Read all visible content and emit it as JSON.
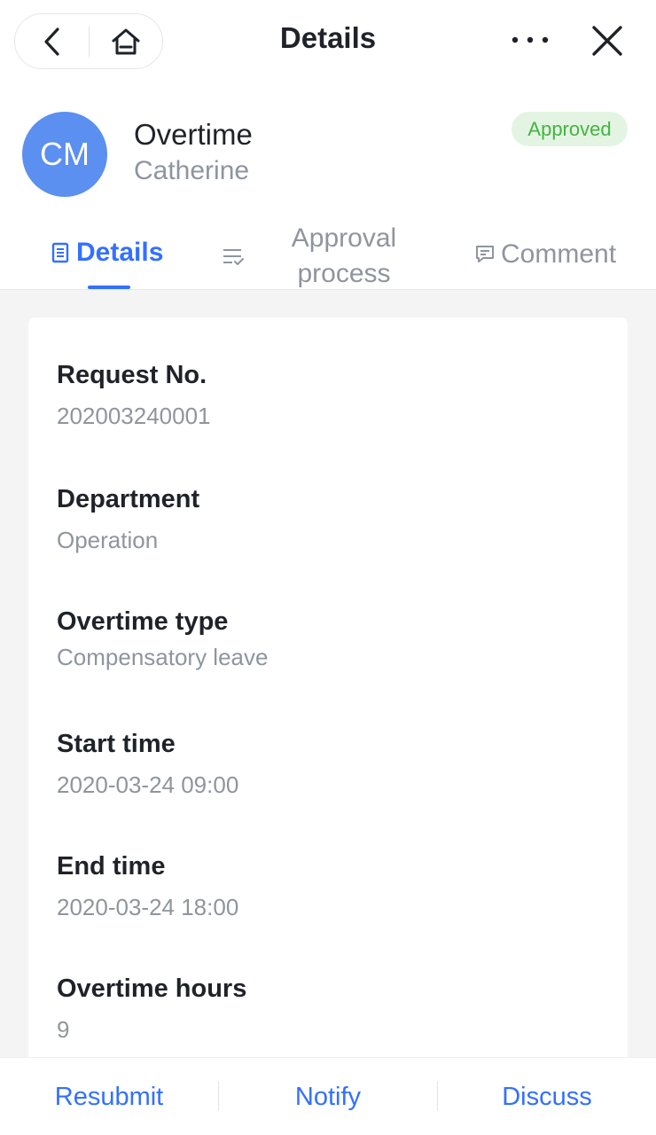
{
  "header": {
    "title": "Details",
    "back_icon": "chevron-left-icon",
    "home_icon": "home-icon",
    "more_icon": "more-horizontal-icon",
    "close_icon": "close-icon"
  },
  "request": {
    "avatar_initials": "CM",
    "avatar_color": "#5b8ff0",
    "title": "Overtime",
    "applicant": "Catherine",
    "status": "Approved",
    "status_color": "#45b342"
  },
  "tabs": [
    {
      "label": "Details",
      "icon": "document-icon",
      "active": true
    },
    {
      "label": "Approval process",
      "icon": "list-check-icon",
      "active": false
    },
    {
      "label": "Comment",
      "icon": "comment-icon",
      "active": false
    }
  ],
  "fields": [
    {
      "label": "Request No.",
      "value": "202003240001"
    },
    {
      "label": "Department",
      "value": "Operation"
    },
    {
      "label": "Overtime type",
      "value": "Compensatory leave"
    },
    {
      "label": "Start time",
      "value": "2020-03-24 09:00"
    },
    {
      "label": "End time",
      "value": "2020-03-24 18:00"
    },
    {
      "label": "Overtime hours",
      "value": "9"
    }
  ],
  "actions": {
    "resubmit": "Resubmit",
    "notify": "Notify",
    "discuss": "Discuss"
  },
  "colors": {
    "accent": "#3370ff",
    "text_primary": "#1f2329",
    "text_secondary": "#8f959e",
    "background": "#f4f4f5"
  }
}
